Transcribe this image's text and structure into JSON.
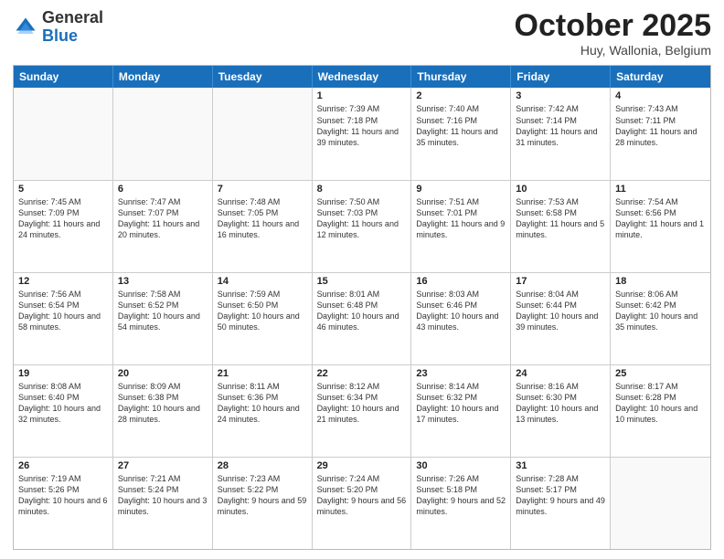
{
  "header": {
    "logo_general": "General",
    "logo_blue": "Blue",
    "month_title": "October 2025",
    "location": "Huy, Wallonia, Belgium"
  },
  "weekdays": [
    "Sunday",
    "Monday",
    "Tuesday",
    "Wednesday",
    "Thursday",
    "Friday",
    "Saturday"
  ],
  "weeks": [
    [
      {
        "day": "",
        "info": ""
      },
      {
        "day": "",
        "info": ""
      },
      {
        "day": "",
        "info": ""
      },
      {
        "day": "1",
        "info": "Sunrise: 7:39 AM\nSunset: 7:18 PM\nDaylight: 11 hours and 39 minutes."
      },
      {
        "day": "2",
        "info": "Sunrise: 7:40 AM\nSunset: 7:16 PM\nDaylight: 11 hours and 35 minutes."
      },
      {
        "day": "3",
        "info": "Sunrise: 7:42 AM\nSunset: 7:14 PM\nDaylight: 11 hours and 31 minutes."
      },
      {
        "day": "4",
        "info": "Sunrise: 7:43 AM\nSunset: 7:11 PM\nDaylight: 11 hours and 28 minutes."
      }
    ],
    [
      {
        "day": "5",
        "info": "Sunrise: 7:45 AM\nSunset: 7:09 PM\nDaylight: 11 hours and 24 minutes."
      },
      {
        "day": "6",
        "info": "Sunrise: 7:47 AM\nSunset: 7:07 PM\nDaylight: 11 hours and 20 minutes."
      },
      {
        "day": "7",
        "info": "Sunrise: 7:48 AM\nSunset: 7:05 PM\nDaylight: 11 hours and 16 minutes."
      },
      {
        "day": "8",
        "info": "Sunrise: 7:50 AM\nSunset: 7:03 PM\nDaylight: 11 hours and 12 minutes."
      },
      {
        "day": "9",
        "info": "Sunrise: 7:51 AM\nSunset: 7:01 PM\nDaylight: 11 hours and 9 minutes."
      },
      {
        "day": "10",
        "info": "Sunrise: 7:53 AM\nSunset: 6:58 PM\nDaylight: 11 hours and 5 minutes."
      },
      {
        "day": "11",
        "info": "Sunrise: 7:54 AM\nSunset: 6:56 PM\nDaylight: 11 hours and 1 minute."
      }
    ],
    [
      {
        "day": "12",
        "info": "Sunrise: 7:56 AM\nSunset: 6:54 PM\nDaylight: 10 hours and 58 minutes."
      },
      {
        "day": "13",
        "info": "Sunrise: 7:58 AM\nSunset: 6:52 PM\nDaylight: 10 hours and 54 minutes."
      },
      {
        "day": "14",
        "info": "Sunrise: 7:59 AM\nSunset: 6:50 PM\nDaylight: 10 hours and 50 minutes."
      },
      {
        "day": "15",
        "info": "Sunrise: 8:01 AM\nSunset: 6:48 PM\nDaylight: 10 hours and 46 minutes."
      },
      {
        "day": "16",
        "info": "Sunrise: 8:03 AM\nSunset: 6:46 PM\nDaylight: 10 hours and 43 minutes."
      },
      {
        "day": "17",
        "info": "Sunrise: 8:04 AM\nSunset: 6:44 PM\nDaylight: 10 hours and 39 minutes."
      },
      {
        "day": "18",
        "info": "Sunrise: 8:06 AM\nSunset: 6:42 PM\nDaylight: 10 hours and 35 minutes."
      }
    ],
    [
      {
        "day": "19",
        "info": "Sunrise: 8:08 AM\nSunset: 6:40 PM\nDaylight: 10 hours and 32 minutes."
      },
      {
        "day": "20",
        "info": "Sunrise: 8:09 AM\nSunset: 6:38 PM\nDaylight: 10 hours and 28 minutes."
      },
      {
        "day": "21",
        "info": "Sunrise: 8:11 AM\nSunset: 6:36 PM\nDaylight: 10 hours and 24 minutes."
      },
      {
        "day": "22",
        "info": "Sunrise: 8:12 AM\nSunset: 6:34 PM\nDaylight: 10 hours and 21 minutes."
      },
      {
        "day": "23",
        "info": "Sunrise: 8:14 AM\nSunset: 6:32 PM\nDaylight: 10 hours and 17 minutes."
      },
      {
        "day": "24",
        "info": "Sunrise: 8:16 AM\nSunset: 6:30 PM\nDaylight: 10 hours and 13 minutes."
      },
      {
        "day": "25",
        "info": "Sunrise: 8:17 AM\nSunset: 6:28 PM\nDaylight: 10 hours and 10 minutes."
      }
    ],
    [
      {
        "day": "26",
        "info": "Sunrise: 7:19 AM\nSunset: 5:26 PM\nDaylight: 10 hours and 6 minutes."
      },
      {
        "day": "27",
        "info": "Sunrise: 7:21 AM\nSunset: 5:24 PM\nDaylight: 10 hours and 3 minutes."
      },
      {
        "day": "28",
        "info": "Sunrise: 7:23 AM\nSunset: 5:22 PM\nDaylight: 9 hours and 59 minutes."
      },
      {
        "day": "29",
        "info": "Sunrise: 7:24 AM\nSunset: 5:20 PM\nDaylight: 9 hours and 56 minutes."
      },
      {
        "day": "30",
        "info": "Sunrise: 7:26 AM\nSunset: 5:18 PM\nDaylight: 9 hours and 52 minutes."
      },
      {
        "day": "31",
        "info": "Sunrise: 7:28 AM\nSunset: 5:17 PM\nDaylight: 9 hours and 49 minutes."
      },
      {
        "day": "",
        "info": ""
      }
    ]
  ]
}
